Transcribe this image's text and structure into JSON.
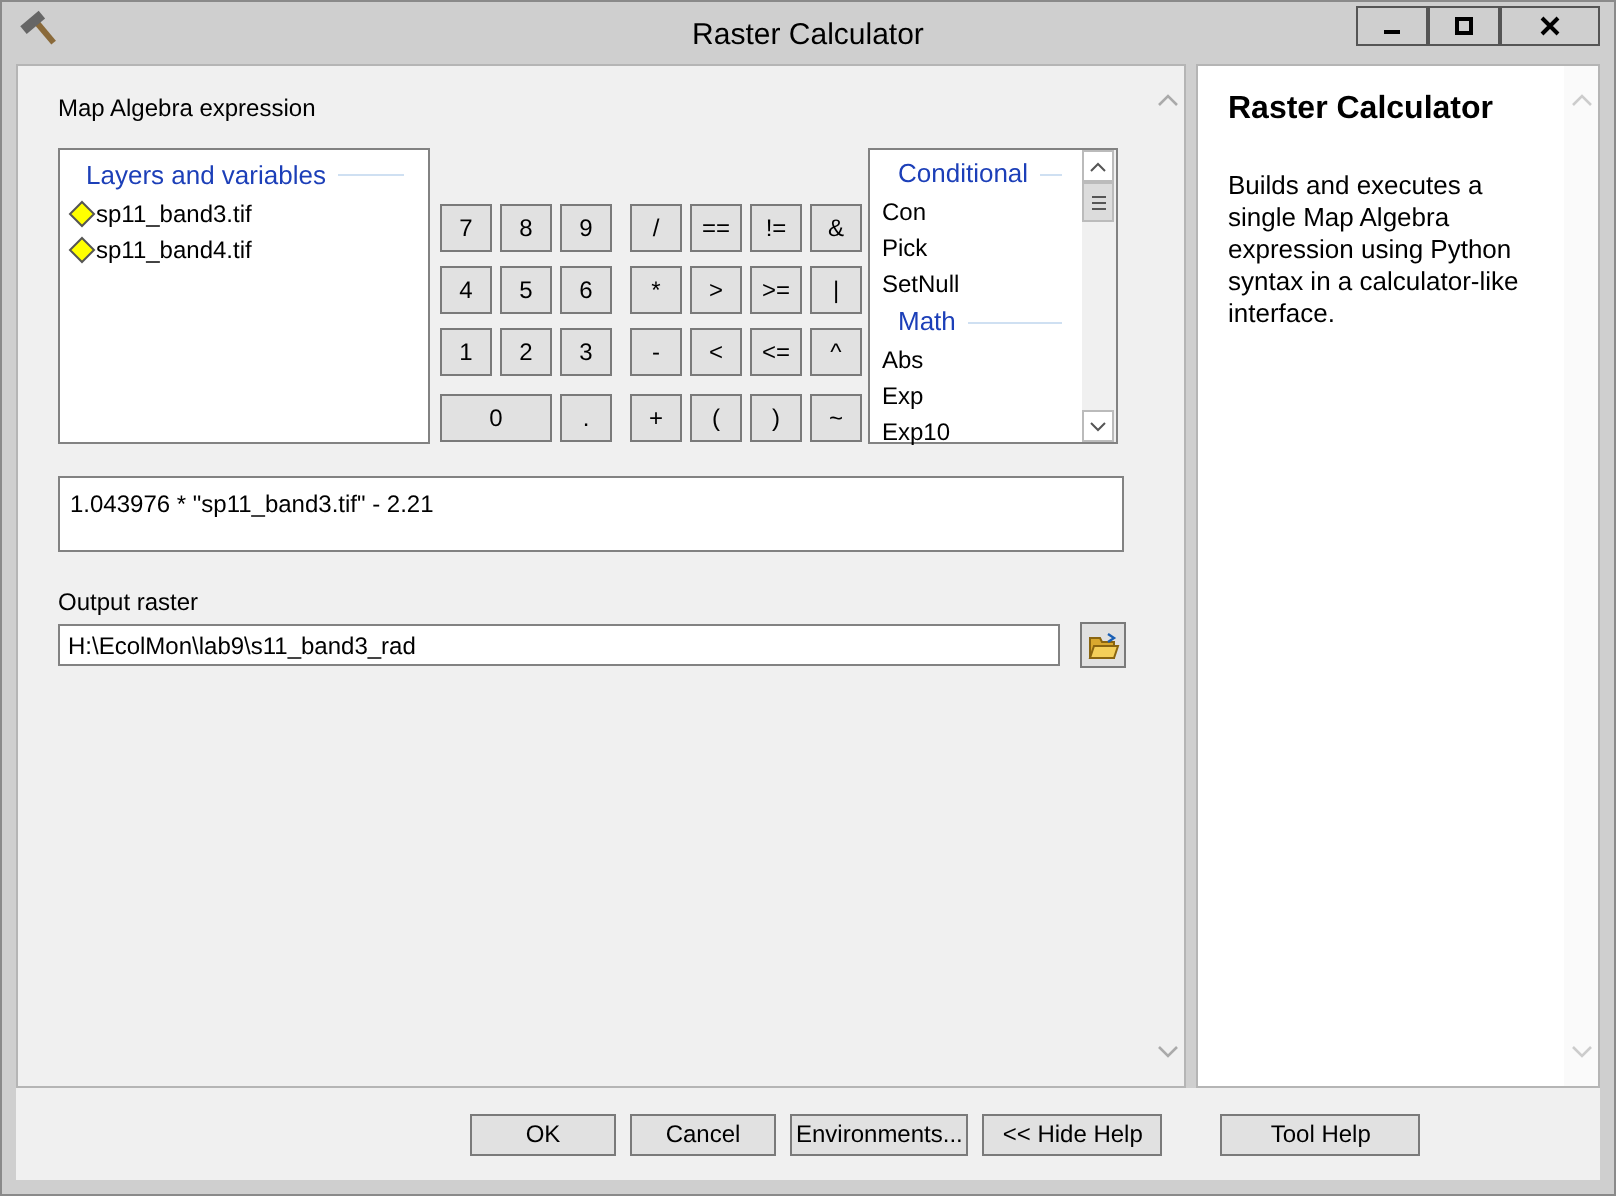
{
  "window": {
    "title": "Raster Calculator"
  },
  "expression_label": "Map Algebra expression",
  "layers": {
    "heading": "Layers and variables",
    "items": [
      "sp11_band3.tif",
      "sp11_band4.tif"
    ]
  },
  "keypad": {
    "digits": [
      {
        "label": "7",
        "kind": "normal"
      },
      {
        "label": "8",
        "kind": "normal"
      },
      {
        "label": "9",
        "kind": "normal"
      },
      {
        "label": "4",
        "kind": "normal"
      },
      {
        "label": "5",
        "kind": "normal"
      },
      {
        "label": "6",
        "kind": "normal"
      },
      {
        "label": "1",
        "kind": "normal"
      },
      {
        "label": "2",
        "kind": "normal"
      },
      {
        "label": "3",
        "kind": "normal"
      },
      {
        "label": "0",
        "kind": "wide"
      },
      {
        "label": ".",
        "kind": "normal"
      }
    ],
    "operators": [
      "/",
      "==",
      "!=",
      "&",
      "*",
      ">",
      ">=",
      "|",
      "-",
      "<",
      "<=",
      "^",
      "+",
      "(",
      ")",
      "~"
    ]
  },
  "functions": {
    "groups": [
      {
        "heading": "Conditional",
        "items": [
          "Con",
          "Pick",
          "SetNull"
        ]
      },
      {
        "heading": "Math",
        "items": [
          "Abs",
          "Exp",
          "Exp10"
        ]
      }
    ]
  },
  "expression": "1.043976 * \"sp11_band3.tif\" - 2.21",
  "output": {
    "label": "Output raster",
    "value": "H:\\EcolMon\\lab9\\s11_band3_rad"
  },
  "help": {
    "title": "Raster Calculator",
    "text": "Builds and executes a single Map Algebra expression using Python syntax in a calculator-like interface."
  },
  "buttons": {
    "dialog": [
      "OK",
      "Cancel",
      "Environments...",
      "<< Hide Help"
    ],
    "help": [
      "Tool Help"
    ]
  }
}
